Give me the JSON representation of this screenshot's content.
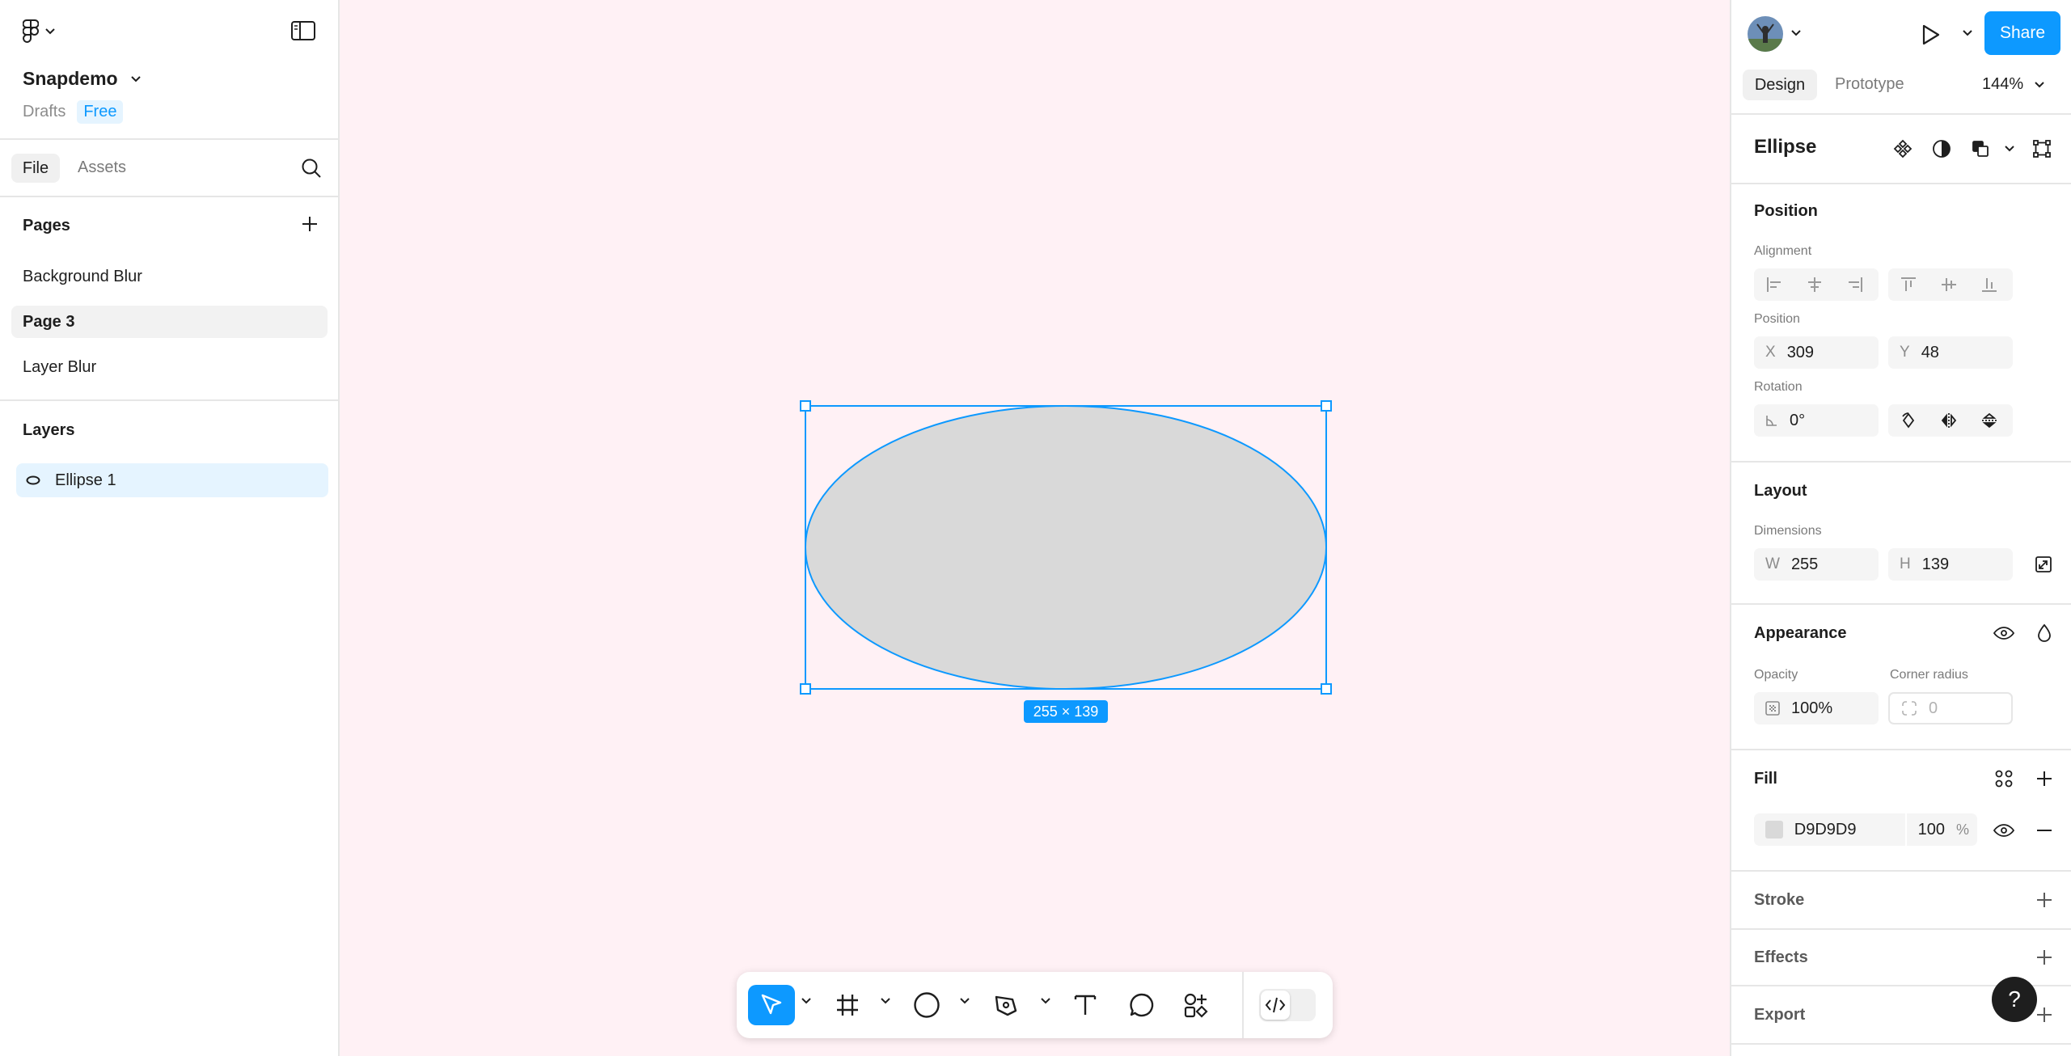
{
  "file": {
    "name": "Snapdemo",
    "location": "Drafts",
    "plan": "Free"
  },
  "left_tabs": {
    "file": "File",
    "assets": "Assets"
  },
  "pages": {
    "title": "Pages",
    "items": [
      "Background Blur",
      "Page 3",
      "Layer Blur"
    ],
    "active": "Page 3"
  },
  "layers": {
    "title": "Layers",
    "items": [
      {
        "name": "Ellipse 1",
        "icon": "ellipse-icon"
      }
    ]
  },
  "canvas": {
    "background": "#fff1f5",
    "selection_label": "255 × 139",
    "shape_fill": "#D9D9D9",
    "selection_color": "#0d99ff"
  },
  "header": {
    "share": "Share"
  },
  "right_tabs": {
    "design": "Design",
    "prototype": "Prototype",
    "zoom": "144%"
  },
  "design": {
    "object_type": "Ellipse",
    "position": {
      "title": "Position",
      "alignment_label": "Alignment",
      "position_label": "Position",
      "x_label": "X",
      "x": "309",
      "y_label": "Y",
      "y": "48",
      "rotation_label": "Rotation",
      "rotation": "0°"
    },
    "layout": {
      "title": "Layout",
      "dimensions_label": "Dimensions",
      "w_label": "W",
      "w": "255",
      "h_label": "H",
      "h": "139"
    },
    "appearance": {
      "title": "Appearance",
      "opacity_label": "Opacity",
      "opacity": "100%",
      "corner_label": "Corner radius",
      "corner": "0"
    },
    "fill": {
      "title": "Fill",
      "hex": "D9D9D9",
      "opacity": "100",
      "unit": "%"
    },
    "stroke": {
      "title": "Stroke"
    },
    "effects": {
      "title": "Effects"
    },
    "export": {
      "title": "Export"
    }
  },
  "help": "?"
}
